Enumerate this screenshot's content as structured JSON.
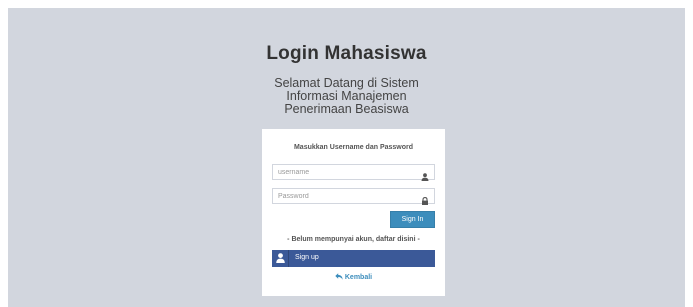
{
  "page": {
    "title": "Login Mahasiswa",
    "subtitle_lines": [
      "Selamat Datang di Sistem",
      "Informasi Manajemen",
      "Penerimaan Beasiswa"
    ]
  },
  "login_box": {
    "message": "Masukkan Username dan Password",
    "username": {
      "value": "",
      "placeholder": "username",
      "icon": "user-icon"
    },
    "password": {
      "value": "",
      "placeholder": "Password",
      "icon": "lock-icon"
    },
    "signin_label": "Sign In",
    "register_prompt": "- Belum mempunyai akun, daftar disini -",
    "signup": {
      "label": "Sign up",
      "icon": "user-icon"
    },
    "back": {
      "label": "Kembali",
      "icon": "reply-icon"
    }
  },
  "colors": {
    "background": "#d2d6de",
    "primary": "#3c8dbc",
    "signup": "#3b5998"
  }
}
